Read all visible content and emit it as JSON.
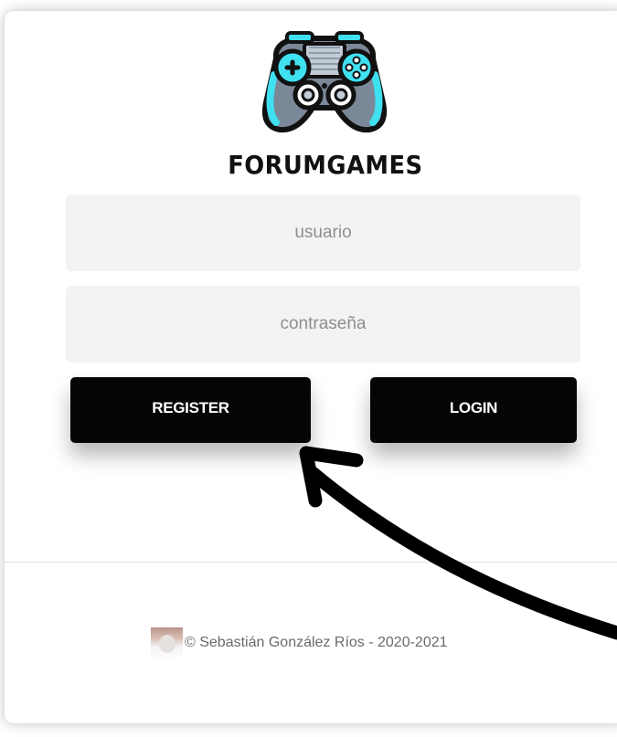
{
  "brand": {
    "name": "FORUMGAMES",
    "logo_icon": "gamepad-icon"
  },
  "form": {
    "username_placeholder": "usuario",
    "password_placeholder": "contraseña",
    "register_label": "REGISTER",
    "login_label": "LOGIN"
  },
  "footer": {
    "avatar_icon": "author-avatar",
    "copyright": "© Sebastián González Ríos - 2020-2021"
  },
  "annotation": {
    "icon": "curved-arrow-icon"
  },
  "colors": {
    "button_bg": "#050505",
    "button_text": "#ffffff",
    "field_bg": "#f3f3f3",
    "logo_accent": "#3fe0f0"
  }
}
